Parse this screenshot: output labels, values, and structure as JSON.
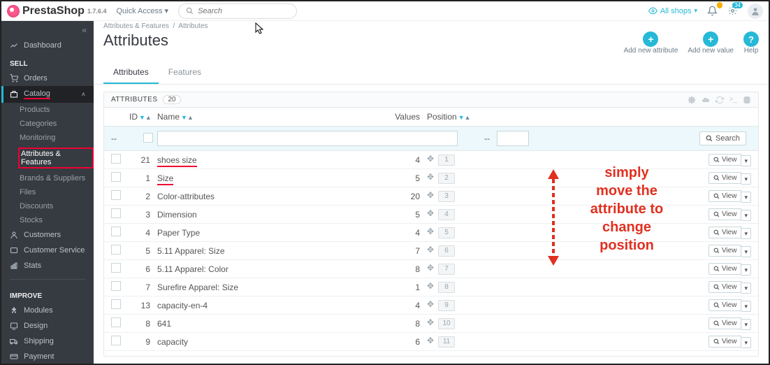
{
  "header": {
    "brand": "PrestaShop",
    "version": "1.7.6.4",
    "quick_access": "Quick Access",
    "search_placeholder": "Search",
    "all_shops": "All shops",
    "bell_badge": "",
    "cart_badge": "34"
  },
  "sidebar": {
    "dashboard": "Dashboard",
    "sell": "SELL",
    "orders": "Orders",
    "catalog": "Catalog",
    "catalog_items": {
      "products": "Products",
      "categories": "Categories",
      "monitoring": "Monitoring",
      "attributes": "Attributes & Features",
      "brands": "Brands & Suppliers",
      "files": "Files",
      "discounts": "Discounts",
      "stocks": "Stocks"
    },
    "customers": "Customers",
    "cs": "Customer Service",
    "stats": "Stats",
    "improve": "IMPROVE",
    "modules": "Modules",
    "design": "Design",
    "shipping": "Shipping",
    "payment": "Payment"
  },
  "breadcrumb": {
    "a": "Attributes & Features",
    "b": "Attributes"
  },
  "page": {
    "title": "Attributes",
    "act_add_attr": "Add new attribute",
    "act_add_val": "Add new value",
    "act_help": "Help"
  },
  "tabs": {
    "attributes": "Attributes",
    "features": "Features"
  },
  "panel": {
    "title": "ATTRIBUTES",
    "count": "20",
    "search": "Search",
    "view": "View",
    "th_id": "ID",
    "th_name": "Name",
    "th_values": "Values",
    "th_position": "Position"
  },
  "rows": [
    {
      "id": "21",
      "name": "shoes size",
      "values": "4",
      "pos": "1",
      "hl": true
    },
    {
      "id": "1",
      "name": "Size",
      "values": "5",
      "pos": "2",
      "hl": true
    },
    {
      "id": "2",
      "name": "Color-attributes",
      "values": "20",
      "pos": "3"
    },
    {
      "id": "3",
      "name": "Dimension",
      "values": "5",
      "pos": "4"
    },
    {
      "id": "4",
      "name": "Paper Type",
      "values": "4",
      "pos": "5"
    },
    {
      "id": "5",
      "name": "5.11 Apparel: Size",
      "values": "7",
      "pos": "6"
    },
    {
      "id": "6",
      "name": "5.11 Apparel: Color",
      "values": "8",
      "pos": "7"
    },
    {
      "id": "7",
      "name": "Surefire Apparel: Size",
      "values": "1",
      "pos": "8"
    },
    {
      "id": "13",
      "name": "capacity-en-4",
      "values": "4",
      "pos": "9"
    },
    {
      "id": "8",
      "name": "641",
      "values": "8",
      "pos": "10"
    },
    {
      "id": "9",
      "name": "capacity",
      "values": "6",
      "pos": "11"
    }
  ],
  "annotation": {
    "l1": "simply",
    "l2": "move the",
    "l3": "attribute to",
    "l4": "change",
    "l5": "position"
  }
}
